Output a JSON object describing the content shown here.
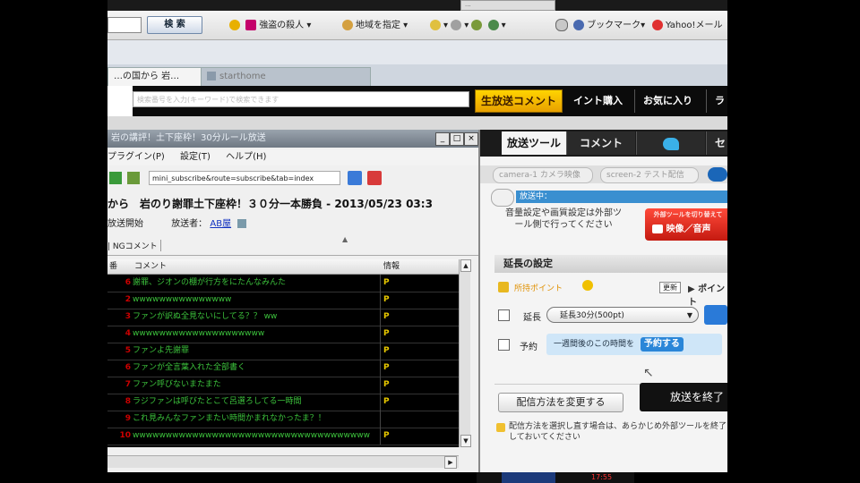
{
  "top_chip": "...",
  "toolbar": {
    "search_label": "検 索",
    "items": [
      "強盗の殺人",
      "地域を指定",
      "ブックマーク▾",
      "Yahoo!メール"
    ]
  },
  "tabs": [
    "…の国から 岩…",
    "starthome"
  ],
  "header": {
    "url_placeholder": "検索番号を入力(キーワード)で検索できます",
    "comment_badge": "生放送コメント",
    "links": [
      "イント購入",
      "お気に入り",
      "ラ"
    ]
  },
  "left_window": {
    "title": "岩の講評！土下座枠！30分ルール放送",
    "menu": [
      "プラグイン(P)",
      "設定(T)",
      "ヘルプ(H)"
    ],
    "url": "mini_subscribe&route=subscribe&tab=index",
    "broadcast_title": "から　岩のり謝罪土下座枠！３０分一本勝負 - 2013/05/23 03:3",
    "start_label": "放送開始",
    "broadcaster_label": "放送者：",
    "broadcaster_name": "AB屋",
    "ng_tab": "NGコメント",
    "columns": [
      "番",
      "コメント",
      "情報"
    ],
    "rows": [
      {
        "num": "6",
        "text": "謝罪、ジオンの棚が行方をにたんなみんた",
        "info": "P"
      },
      {
        "num": "2",
        "text": "wwwwwwwwwwwwwww",
        "info": "P"
      },
      {
        "num": "3",
        "text": "ファンが訳ぬ全見ないにしてる？？ ww",
        "info": "P"
      },
      {
        "num": "4",
        "text": "wwwwwwwwwwwwwwwwwwww",
        "info": "P"
      },
      {
        "num": "5",
        "text": "ファンよ先謝罪",
        "info": "P"
      },
      {
        "num": "6",
        "text": "ファンが全言葉入れた全部書く",
        "info": "P"
      },
      {
        "num": "7",
        "text": "ファン呼びないまたまた",
        "info": "P"
      },
      {
        "num": "8",
        "text": "ラジファンは呼びたとこて呂選ろしてる一時間",
        "info": "P"
      },
      {
        "num": "9",
        "text": "これ見みんなファンまたい時間かまれなかったま？！",
        "info": ""
      },
      {
        "num": "10",
        "text": "wwwwwwwwwwwwwwwwwwwwwwwwwwwwwwwwwwww",
        "info": "P"
      }
    ]
  },
  "right_panel": {
    "tabs": [
      "放送ツール",
      "コメント",
      "",
      "セ"
    ],
    "sub_tabs": [
      "camera-1 カメラ映像",
      "screen-2 テスト配信"
    ],
    "status": "放送中：",
    "status_text": "音量設定や画質設定は外部ツール側で行ってください",
    "red_button": "映像／音声",
    "red_button_sub": "外部ツールを切り替えて",
    "ext_heading": "延長の設定",
    "points_label": "所持ポイント",
    "update_label": "更新",
    "point_label": "ポイント",
    "extend_label": "延長",
    "extend_value": "延長30分(500pt)",
    "reserve_label": "予約",
    "reserve_text": "一週間後のこの時間を",
    "reserve_button": "予約する",
    "change_button": "配信方法を変更する",
    "end_button": "放送を終了",
    "notice": "配信方法を選択し直す場合は、あらかじめ外部ツールを終了しておいてください"
  },
  "bottom_chip": "17:55"
}
